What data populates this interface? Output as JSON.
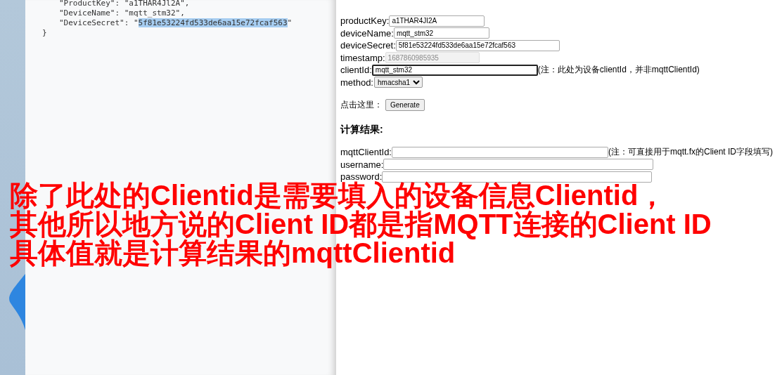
{
  "code_panel": {
    "lines": [
      {
        "text": "\"ProductKey\": \"a1THAR4Jl2A\","
      },
      {
        "text": "\"DeviceName\": \"mqtt_stm32\","
      },
      {
        "text": "\"DeviceSecret\": \"",
        "selection": "5f81e53224fd533de6aa15e72fcaf563",
        "after": "\""
      },
      {
        "text": "}",
        "kind": "close"
      }
    ]
  },
  "device_form": {
    "fields": [
      {
        "kind": "text",
        "label": "productKey:",
        "value": "a1THAR4JI2A",
        "disabled": false,
        "focused": false
      },
      {
        "kind": "text",
        "label": "deviceName:",
        "value": "mqtt_stm32",
        "disabled": false,
        "focused": false
      },
      {
        "kind": "text",
        "label": "deviceSecret:",
        "value": "5f81e53224fd533de6aa15e72fcaf563",
        "disabled": false,
        "focused": false
      },
      {
        "kind": "text",
        "label": "timestamp:",
        "value": "1687860985935",
        "disabled": true,
        "focused": false
      },
      {
        "kind": "text",
        "label": "clientId:",
        "value": "mqtt_stm32",
        "disabled": false,
        "focused": true,
        "note": "(注：此处为设备clientId，并非mqttClientId)"
      },
      {
        "kind": "select",
        "label": "method:",
        "value": "hmacsha1"
      }
    ],
    "generate": {
      "label": "点击这里：",
      "button": "Generate"
    }
  },
  "result": {
    "heading": "计算结果:",
    "fields": [
      {
        "label": "mqttClientId:",
        "note": "(注：可直接用于mqtt.fx的Client ID字段填写)"
      },
      {
        "label": "username:"
      },
      {
        "label": "password:"
      }
    ]
  },
  "caption": {
    "lines": [
      "除了此处的Clientid是需要填入的设备信息Clientid，",
      "其他所以地方说的Client ID都是指MQTT连接的Client ID",
      "具体值就是计算结果的mqttClientid"
    ]
  }
}
